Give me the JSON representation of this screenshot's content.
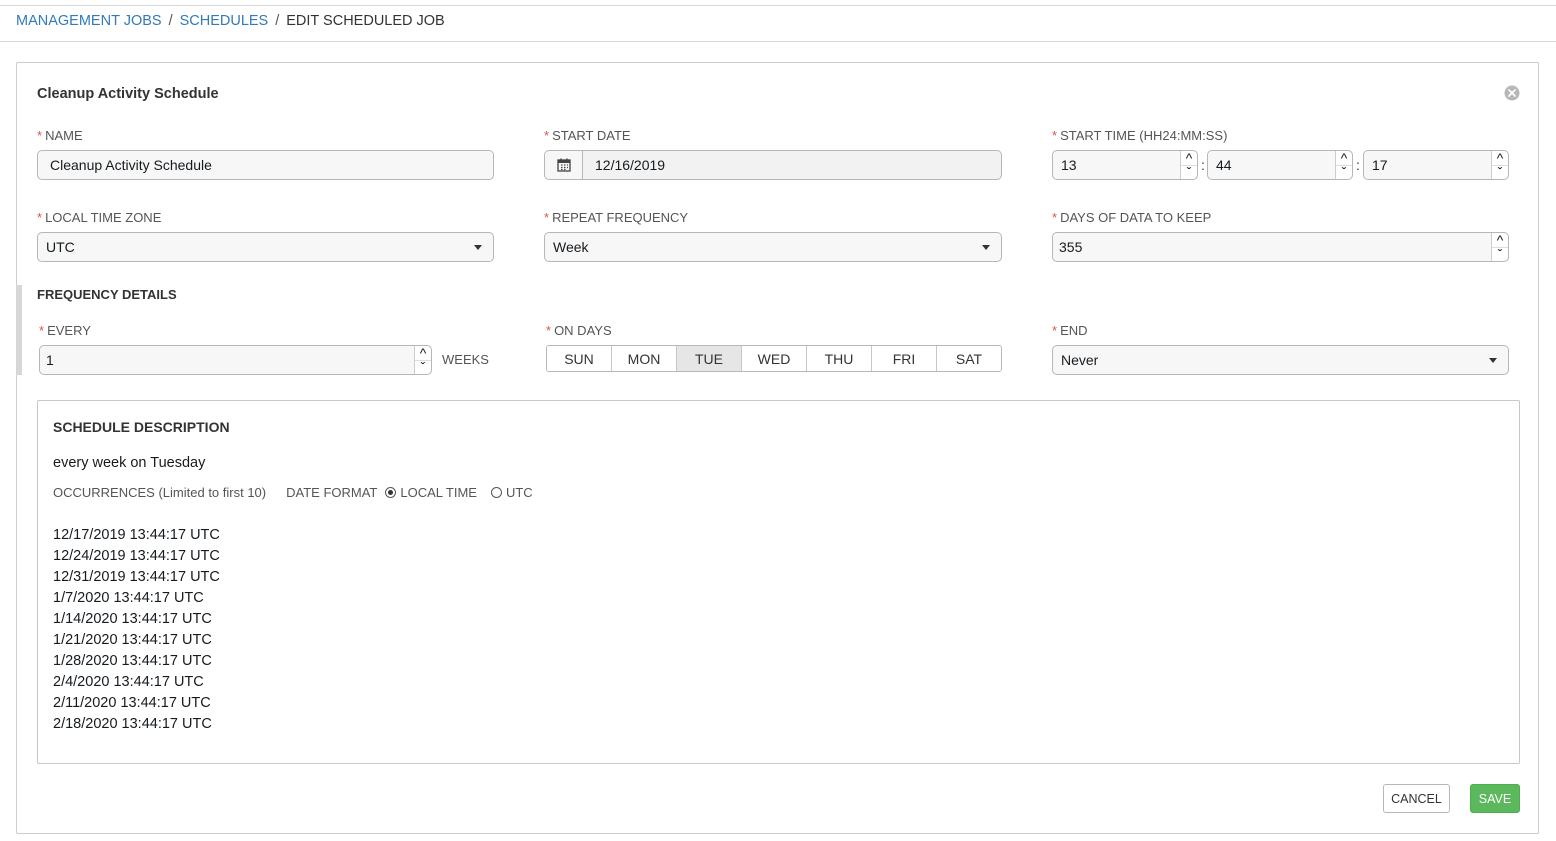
{
  "breadcrumb": {
    "items": [
      "MANAGEMENT JOBS",
      "SCHEDULES"
    ],
    "separator": "/",
    "current": "EDIT SCHEDULED JOB"
  },
  "panel": {
    "title": "Cleanup Activity Schedule"
  },
  "form": {
    "required_mark": "*",
    "name": {
      "label": "NAME",
      "value": "Cleanup Activity Schedule"
    },
    "start_date": {
      "label": "START DATE",
      "value": "12/16/2019"
    },
    "start_time": {
      "label": "START TIME (HH24:MM:SS)",
      "hour": "13",
      "minute": "44",
      "second": "17",
      "separator": ":"
    },
    "time_zone": {
      "label": "LOCAL TIME ZONE",
      "value": "UTC"
    },
    "repeat_frequency": {
      "label": "REPEAT FREQUENCY",
      "value": "Week"
    },
    "days_to_keep": {
      "label": "DAYS OF DATA TO KEEP",
      "value": "355"
    }
  },
  "frequency": {
    "title": "FREQUENCY DETAILS",
    "every": {
      "label": "EVERY",
      "value": "1",
      "unit": "WEEKS"
    },
    "on_days": {
      "label": "ON DAYS",
      "days": [
        "SUN",
        "MON",
        "TUE",
        "WED",
        "THU",
        "FRI",
        "SAT"
      ],
      "selected": "TUE"
    },
    "end": {
      "label": "END",
      "value": "Never"
    }
  },
  "schedule_description": {
    "title": "SCHEDULE DESCRIPTION",
    "text": "every week on Tuesday",
    "occurrences_label": "OCCURRENCES",
    "occurrences_note": "(Limited to first 10)",
    "date_format_label": "DATE FORMAT",
    "options": [
      "LOCAL TIME",
      "UTC"
    ],
    "selected_option": "LOCAL TIME",
    "occurrences": [
      "12/17/2019 13:44:17 UTC",
      "12/24/2019 13:44:17 UTC",
      "12/31/2019 13:44:17 UTC",
      "1/7/2020 13:44:17 UTC",
      "1/14/2020 13:44:17 UTC",
      "1/21/2020 13:44:17 UTC",
      "1/28/2020 13:44:17 UTC",
      "2/4/2020 13:44:17 UTC",
      "2/11/2020 13:44:17 UTC",
      "2/18/2020 13:44:17 UTC"
    ]
  },
  "buttons": {
    "cancel": "CANCEL",
    "save": "SAVE"
  },
  "colors": {
    "link": "#337ab7",
    "required": "#d9534f",
    "save": "#5cb85c"
  }
}
